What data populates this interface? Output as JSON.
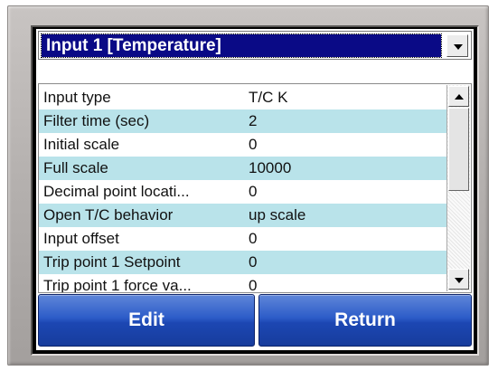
{
  "dropdown": {
    "selected": "Input 1 [Temperature]"
  },
  "list": {
    "rows": [
      {
        "name": "Input type",
        "value": "T/C K"
      },
      {
        "name": "Filter time (sec)",
        "value": "2"
      },
      {
        "name": "Initial scale",
        "value": "0"
      },
      {
        "name": "Full scale",
        "value": "10000"
      },
      {
        "name": "Decimal point locati...",
        "value": "0"
      },
      {
        "name": "Open T/C behavior",
        "value": "up scale"
      },
      {
        "name": "Input offset",
        "value": "0"
      },
      {
        "name": "Trip point 1 Setpoint",
        "value": "0"
      },
      {
        "name": "Trip point 1 force va...",
        "value": "0"
      }
    ]
  },
  "buttons": {
    "edit": "Edit",
    "return": "Return"
  },
  "colors": {
    "row_alt": "#b9e3ea",
    "selection": "#0a0a86",
    "button": "#2d5cc8"
  }
}
